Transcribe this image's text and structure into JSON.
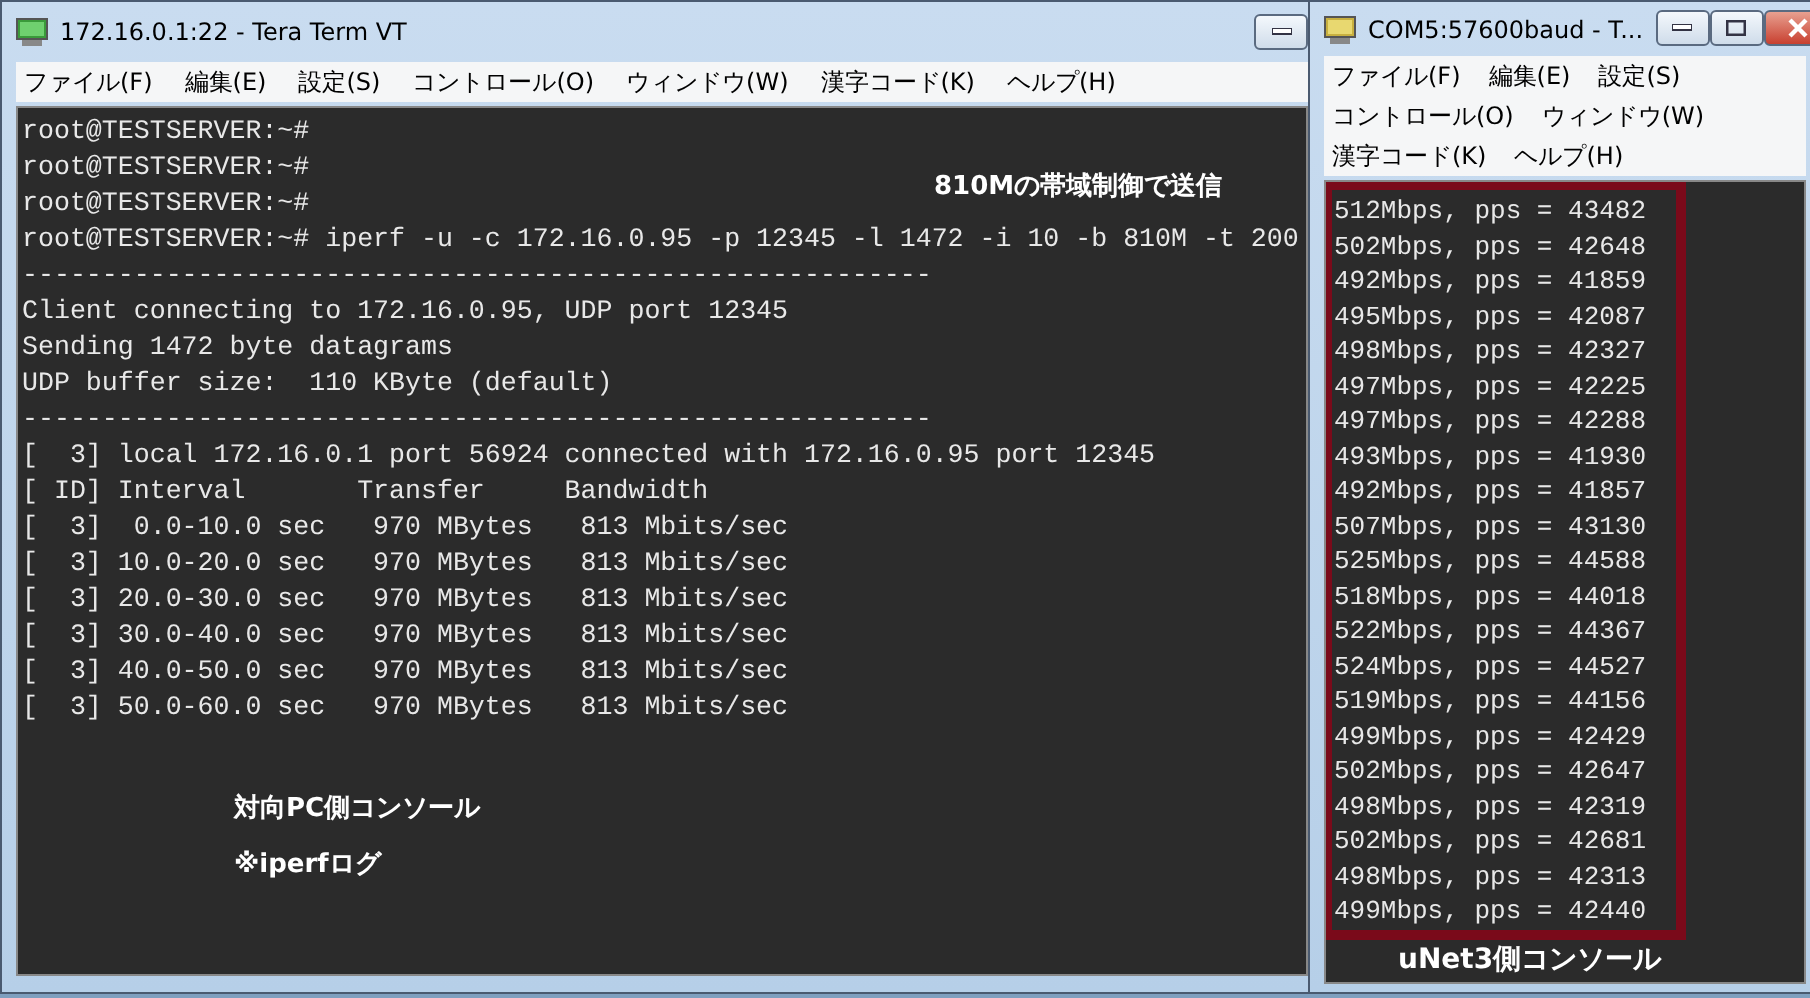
{
  "windows": [
    {
      "kind": "main",
      "title": "172.16.0.1:22 - Tera Term VT",
      "menu_rows": [
        [
          "ファイル(F)",
          "編集(E)",
          "設定(S)",
          "コントロール(O)",
          "ウィンドウ(W)",
          "漢字コード(K)",
          "ヘルプ(H)"
        ]
      ],
      "lines": [
        "root@TESTSERVER:~#",
        "root@TESTSERVER:~#",
        "root@TESTSERVER:~#",
        "root@TESTSERVER:~# iperf -u -c 172.16.0.95 -p 12345 -l 1472 -i 10 -b 810M -t 200",
        "---------------------------------------------------------",
        "Client connecting to 172.16.0.95, UDP port 12345",
        "Sending 1472 byte datagrams",
        "UDP buffer size:  110 KByte (default)",
        "---------------------------------------------------------",
        "[  3] local 172.16.0.1 port 56924 connected with 172.16.0.95 port 12345",
        "[ ID] Interval       Transfer     Bandwidth",
        "[  3]  0.0-10.0 sec   970 MBytes   813 Mbits/sec",
        "[  3] 10.0-20.0 sec   970 MBytes   813 Mbits/sec",
        "[  3] 20.0-30.0 sec   970 MBytes   813 Mbits/sec",
        "[  3] 30.0-40.0 sec   970 MBytes   813 Mbits/sec",
        "[  3] 40.0-50.0 sec   970 MBytes   813 Mbits/sec",
        "[  3] 50.0-60.0 sec   970 MBytes   813 Mbits/sec"
      ],
      "annotations": [
        "810Mの帯域制御で送信",
        "対向PC側コンソール",
        "※iperfログ"
      ]
    },
    {
      "kind": "side",
      "title": "COM5:57600baud - T...",
      "menu_rows": [
        [
          "ファイル(F)",
          "編集(E)",
          "設定(S)"
        ],
        [
          "コントロール(O)",
          "ウィンドウ(W)"
        ],
        [
          "漢字コード(K)",
          "ヘルプ(H)"
        ]
      ],
      "lines": [
        "512Mbps, pps = 43482",
        "502Mbps, pps = 42648",
        "492Mbps, pps = 41859",
        "495Mbps, pps = 42087",
        "498Mbps, pps = 42327",
        "497Mbps, pps = 42225",
        "497Mbps, pps = 42288",
        "493Mbps, pps = 41930",
        "492Mbps, pps = 41857",
        "507Mbps, pps = 43130",
        "525Mbps, pps = 44588",
        "518Mbps, pps = 44018",
        "522Mbps, pps = 44367",
        "524Mbps, pps = 44527",
        "519Mbps, pps = 44156",
        "499Mbps, pps = 42429",
        "502Mbps, pps = 42647",
        "498Mbps, pps = 42319",
        "502Mbps, pps = 42681",
        "498Mbps, pps = 42313",
        "499Mbps, pps = 42440"
      ],
      "annotations": [
        "uNet3側コンソール"
      ]
    }
  ]
}
